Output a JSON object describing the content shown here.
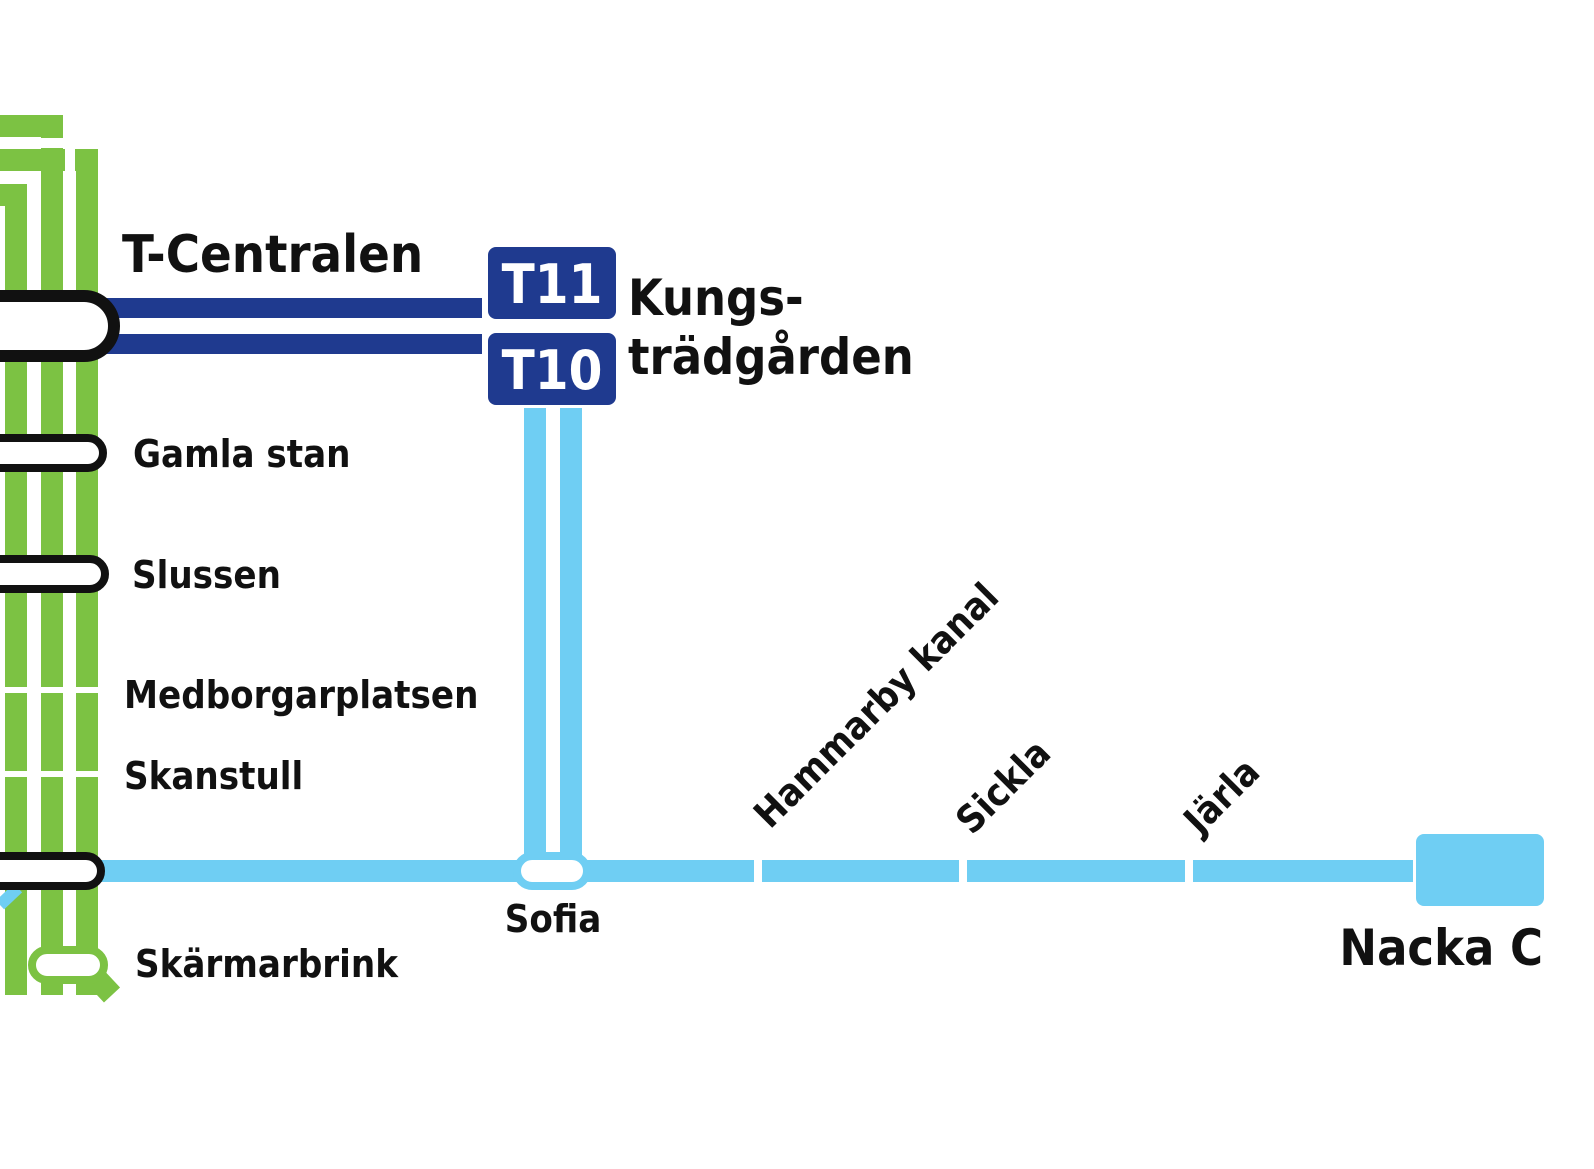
{
  "colors": {
    "green": "#7cc243",
    "dark_blue": "#1f3a8f",
    "light_blue": "#6fcef3",
    "station_outline": "#111111",
    "background": "#ffffff"
  },
  "badges": {
    "t11": "T11",
    "t10": "T10"
  },
  "stations": {
    "t_centralen": "T-Centralen",
    "kungstradgarden_line1": "Kungs-",
    "kungstradgarden_line2": "trädgården",
    "gamla_stan": "Gamla stan",
    "slussen": "Slussen",
    "medborgarplatsen": "Medborgarplatsen",
    "skanstull": "Skanstull",
    "skarmarbrink": "Skärmarbrink",
    "sofia": "Sofia",
    "hammarby_kanal": "Hammarby kanal",
    "sickla": "Sickla",
    "jarla": "Järla",
    "nacka_c": "Nacka C"
  }
}
